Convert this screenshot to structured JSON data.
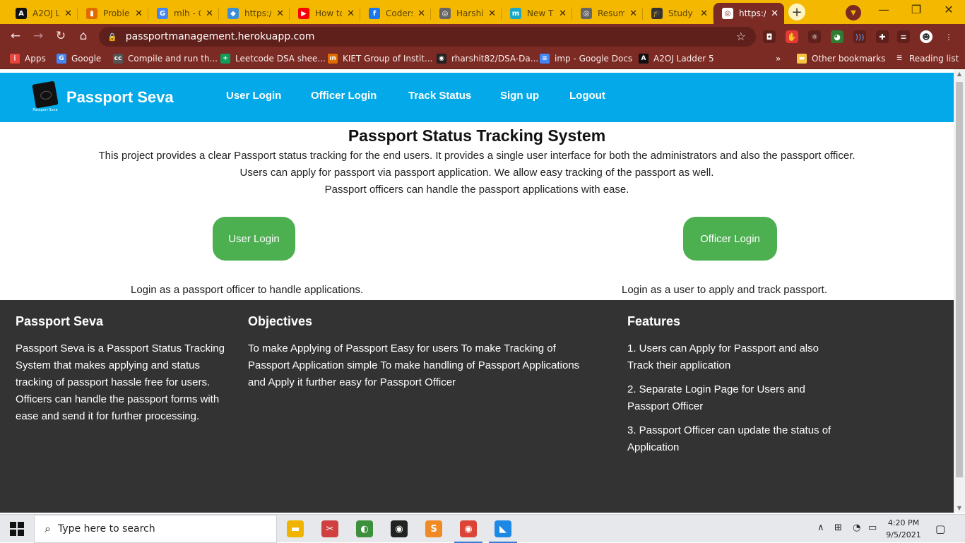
{
  "browser": {
    "tabs": [
      {
        "title": "A2OJ L",
        "icon": "a2oj-icon",
        "color": "#111111",
        "glyph": "A"
      },
      {
        "title": "Proble",
        "icon": "chart-icon",
        "color": "#e06c00",
        "glyph": "▮"
      },
      {
        "title": "mlh - G",
        "icon": "google-icon",
        "color": "#4285f4",
        "glyph": "G"
      },
      {
        "title": "https:/",
        "icon": "diamond-icon",
        "color": "#3d8ed8",
        "glyph": "◆"
      },
      {
        "title": "How to",
        "icon": "youtube-icon",
        "color": "#ff0000",
        "glyph": "▶"
      },
      {
        "title": "Coders",
        "icon": "facebook-icon",
        "color": "#1877f2",
        "glyph": "f"
      },
      {
        "title": "Harshi",
        "icon": "globe-icon",
        "color": "#666666",
        "glyph": "◎"
      },
      {
        "title": "New T",
        "icon": "m-icon",
        "color": "#19a7c7",
        "glyph": "m"
      },
      {
        "title": "Resum",
        "icon": "globe-icon",
        "color": "#666666",
        "glyph": "◎"
      },
      {
        "title": "Study",
        "icon": "graduation-cap-icon",
        "color": "#333333",
        "glyph": "🎓"
      },
      {
        "title": "https:/",
        "icon": "globe-icon",
        "color": "#ffffff",
        "glyph": "◎",
        "active": true
      }
    ],
    "close_glyph": "✕",
    "new_tab_glyph": "+",
    "url": "passportmanagement.herokuapp.com",
    "bookmarks": [
      {
        "label": "Apps",
        "icon": "apps-grid-icon",
        "color": "#e8453c",
        "glyph": "⋮"
      },
      {
        "label": "Google",
        "icon": "google-icon",
        "color": "#4285f4",
        "glyph": "G"
      },
      {
        "label": "Compile and run th...",
        "icon": "cc-icon",
        "color": "#555555",
        "glyph": "cc"
      },
      {
        "label": "Leetcode DSA shee...",
        "icon": "sheets-icon",
        "color": "#0f9d58",
        "glyph": "+"
      },
      {
        "label": "KIET Group of Instit...",
        "icon": "kiet-icon",
        "color": "#e06c00",
        "glyph": "ın"
      },
      {
        "label": "rharshit82/DSA-Da...",
        "icon": "github-icon",
        "color": "#222222",
        "glyph": "◉"
      },
      {
        "label": "imp - Google Docs",
        "icon": "docs-icon",
        "color": "#4285f4",
        "glyph": "≡"
      },
      {
        "label": "A2OJ Ladder 5",
        "icon": "a2oj-icon",
        "color": "#111111",
        "glyph": "A"
      }
    ],
    "more_bookmarks_glyph": "»",
    "other_bookmarks": "Other bookmarks",
    "reading_list": "Reading list"
  },
  "site": {
    "brand": "Passport Seva",
    "logo_caption": "Passport Seva",
    "nav": [
      "User Login",
      "Officer Login",
      "Track Status",
      "Sign up",
      "Logout"
    ],
    "heading": "Passport Status Tracking System",
    "description": [
      "This project provides a clear Passport status tracking for the end users. It provides a single user interface for both the administrators and also the passport officer.",
      "Users can apply for passport via passport application. We allow easy tracking of the passport as well.",
      "Passport officers can handle the passport applications with ease."
    ],
    "buttons": {
      "user_login": "User Login",
      "officer_login": "Officer Login"
    },
    "captions": {
      "left": "Login as a passport officer to handle applications.",
      "right": "Login as a user to apply and track passport."
    },
    "button_color": "#4caf50",
    "nav_color": "#03a9e8",
    "footer": {
      "about": {
        "title": "Passport Seva",
        "lines": [
          "Passport Seva is a Passport Status Tracking",
          "System that makes applying and status",
          "tracking of passport hassle free for users.",
          "Officers can handle the passport forms with",
          "ease and send it for further processing."
        ]
      },
      "objectives": {
        "title": "Objectives",
        "lines": [
          "To make Applying of Passport Easy for users To make Tracking of",
          "Passport Application simple To make handling of Passport Applications",
          "and Apply it further easy for Passport Officer"
        ]
      },
      "features": {
        "title": "Features",
        "items": [
          [
            "1. Users can Apply for Passport and also",
            "Track their application"
          ],
          [
            "2. Separate Login Page for Users and",
            "Passport Officer"
          ],
          [
            "3. Passport Officer can update the status of",
            "Application"
          ]
        ]
      }
    }
  },
  "taskbar": {
    "search_placeholder": "Type here to search",
    "time": "4:20 PM",
    "date": "9/5/2021",
    "apps": [
      {
        "name": "file-explorer-icon",
        "color": "#f0b400",
        "glyph": "▬"
      },
      {
        "name": "snipping-tool-icon",
        "color": "#d04040",
        "glyph": "✂"
      },
      {
        "name": "globe-app-icon",
        "color": "#3c8f3c",
        "glyph": "◐"
      },
      {
        "name": "github-desktop-icon",
        "color": "#222222",
        "glyph": "◉"
      },
      {
        "name": "sublime-text-icon",
        "color": "#f08a24",
        "glyph": "S"
      },
      {
        "name": "chrome-icon",
        "color": "#db4437",
        "glyph": "◉",
        "running": true
      },
      {
        "name": "vscode-icon",
        "color": "#1e88e5",
        "glyph": "◣",
        "running": true
      }
    ]
  }
}
